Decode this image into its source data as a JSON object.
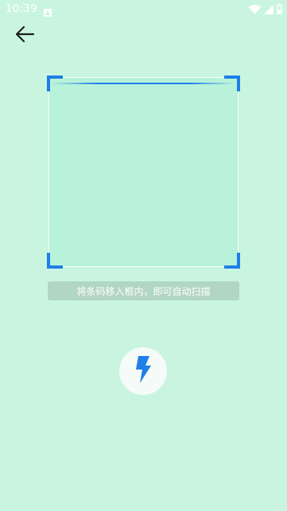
{
  "status_bar": {
    "time": "10:39",
    "notification_icon": "notification-app-icon",
    "wifi_icon": "wifi-icon",
    "signal_icon": "cellular-signal-icon",
    "battery_icon": "battery-icon"
  },
  "toolbar": {
    "back_icon": "arrow-left-icon"
  },
  "scanner": {
    "hint": "将条码移入框内，即可自动扫描",
    "flash_icon": "flash-icon"
  },
  "colors": {
    "background": "#c9f5e0",
    "scan_area": "#b8f2da",
    "accent": "#1f7ee8",
    "hint_bg": "#b2d6c4"
  }
}
